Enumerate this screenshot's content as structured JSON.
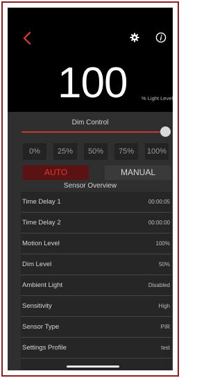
{
  "header": {
    "back_icon": "chevron-left-icon",
    "settings_icon": "gear-icon",
    "info_icon": "info-icon"
  },
  "light": {
    "value": "100",
    "unit_label": "% Light Level"
  },
  "dim_control": {
    "label": "Dim Control",
    "level": 1.0,
    "presets": [
      "0%",
      "25%",
      "50%",
      "75%",
      "100%"
    ]
  },
  "mode": {
    "auto_label": "AUTO",
    "manual_label": "MANUAL",
    "selected": "AUTO"
  },
  "sensor_overview": {
    "title": "Sensor Overview",
    "rows": [
      {
        "label": "Time Delay 1",
        "value": "00:00:05"
      },
      {
        "label": "Time Delay 2",
        "value": "00:00:00"
      },
      {
        "label": "Motion Level",
        "value": "100%"
      },
      {
        "label": "Dim Level",
        "value": "50%"
      },
      {
        "label": "Ambient Light",
        "value": "Disabled"
      },
      {
        "label": "Sensitivity",
        "value": "High"
      },
      {
        "label": "Sensor Type",
        "value": "PIR"
      },
      {
        "label": "Settings Profile",
        "value": "test"
      }
    ]
  },
  "colors": {
    "accent": "#c03a32",
    "frame": "#8f1b1f"
  }
}
